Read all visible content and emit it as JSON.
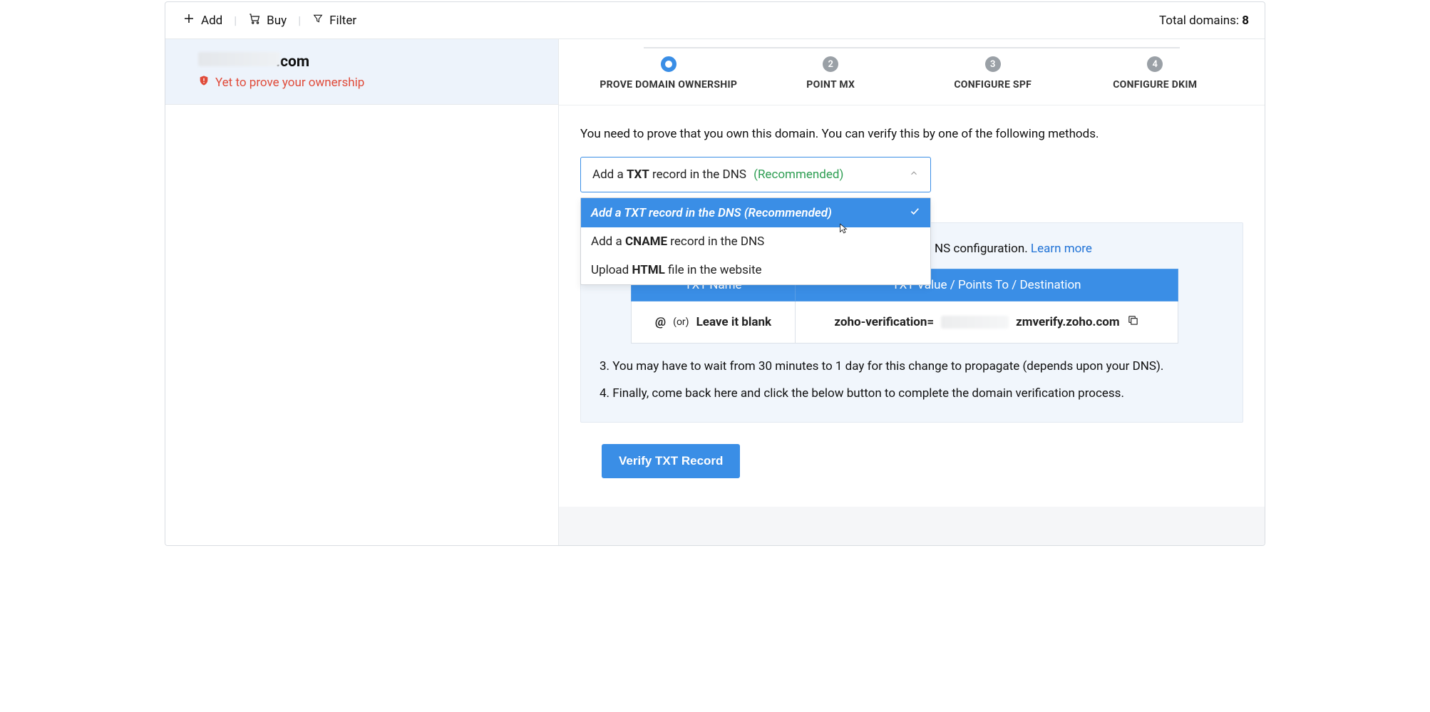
{
  "toolbar": {
    "add_label": "Add",
    "buy_label": "Buy",
    "filter_label": "Filter",
    "total_label": "Total domains:",
    "total_count": "8"
  },
  "sidebar": {
    "domain_suffix": ".com",
    "status_text": "Yet to prove your ownership"
  },
  "stepper": {
    "steps": [
      {
        "label": "PROVE DOMAIN OWNERSHIP"
      },
      {
        "num": "2",
        "label": "POINT MX"
      },
      {
        "num": "3",
        "label": "CONFIGURE SPF"
      },
      {
        "num": "4",
        "label": "CONFIGURE DKIM"
      }
    ]
  },
  "panel": {
    "intro": "You need to prove that you own this domain. You can verify this by one of the following methods."
  },
  "dropdown": {
    "trigger_prefix": "Add a ",
    "trigger_bold": "TXT",
    "trigger_suffix": " record in the DNS",
    "trigger_recommended": "(Recommended)",
    "options": [
      {
        "pre": "Add a ",
        "bold": "TXT",
        "post": " record in the DNS (Recommended)",
        "selected": true
      },
      {
        "pre": "Add a ",
        "bold": "CNAME",
        "post": " record in the DNS",
        "selected": false
      },
      {
        "pre": "Upload ",
        "bold": "HTML",
        "post": " file in the website",
        "selected": false
      }
    ]
  },
  "steps_box": {
    "step2_prefix": "NS configuration. ",
    "step2_link": "Learn more",
    "table": {
      "th_name": "TXT Name",
      "th_value": "TXT Value / Points To / Destination",
      "name_at": "@",
      "name_or": "(or)",
      "name_blank": "Leave it blank",
      "val_prefix": "zoho-verification=",
      "val_suffix": "zmverify.zoho.com"
    },
    "step3": "3. You may have to wait from 30 minutes to 1 day for this change to propagate (depends upon your DNS).",
    "step4": "4. Finally, come back here and click the below button to complete the domain verification process."
  },
  "verify_button": "Verify TXT Record"
}
